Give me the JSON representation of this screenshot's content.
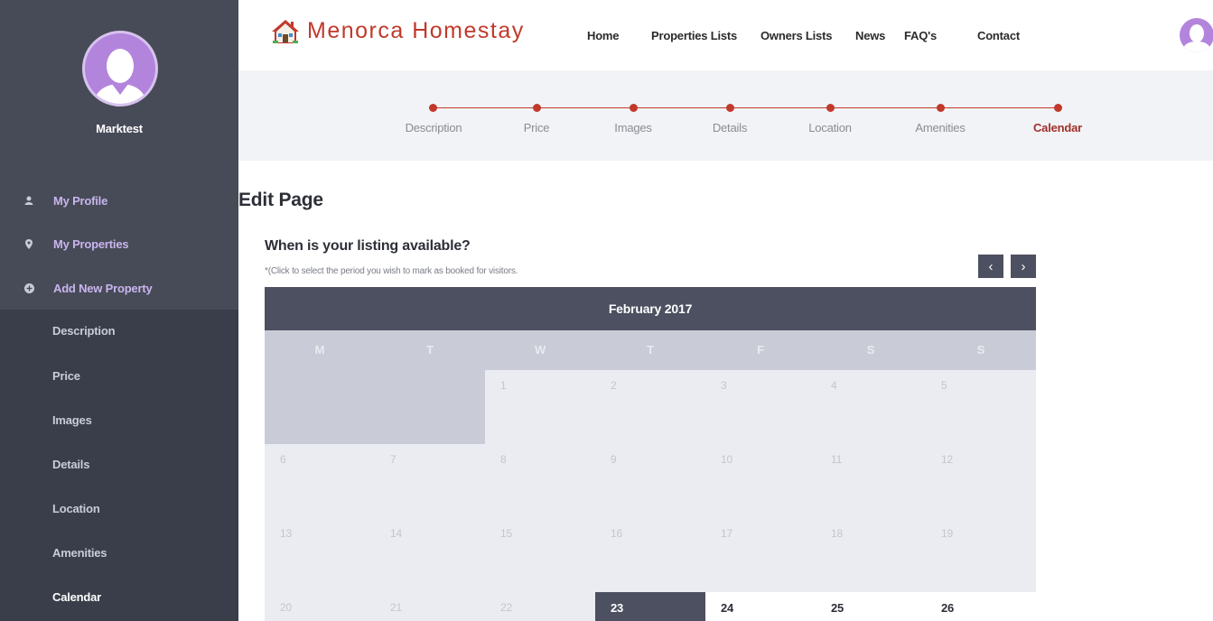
{
  "sidebar": {
    "username": "Marktest",
    "menu": [
      {
        "label": "My Profile",
        "icon": "user-icon"
      },
      {
        "label": "My Properties",
        "icon": "map-pin-icon"
      },
      {
        "label": "Add New Property",
        "icon": "plus-circle-icon"
      }
    ],
    "subitems": [
      "Description",
      "Price",
      "Images",
      "Details",
      "Location",
      "Amenities",
      "Calendar"
    ],
    "active_subitem": "Calendar"
  },
  "topbar": {
    "logo_text": "Menorca Homestay",
    "nav": [
      "Home",
      "Properties Lists",
      "Owners Lists",
      "News",
      "FAQ's",
      "Contact"
    ]
  },
  "stepper": {
    "steps": [
      "Description",
      "Price",
      "Images",
      "Details",
      "Location",
      "Amenities",
      "Calendar"
    ],
    "active_step": "Calendar"
  },
  "main": {
    "page_title": "Edit Page",
    "question": "When is your listing available?",
    "hint": "*(Click to select the period you wish to mark as booked for visitors.",
    "prev_glyph": "‹",
    "next_glyph": "›"
  },
  "calendar": {
    "month_label": "February 2017",
    "weekdays": [
      "M",
      "T",
      "W",
      "T",
      "F",
      "S",
      "S"
    ],
    "rows": [
      [
        "",
        "",
        "1",
        "2",
        "3",
        "4",
        "5"
      ],
      [
        "6",
        "7",
        "8",
        "9",
        "10",
        "11",
        "12"
      ],
      [
        "13",
        "14",
        "15",
        "16",
        "17",
        "18",
        "19"
      ],
      [
        "20",
        "21",
        "22",
        "23",
        "24",
        "25",
        "26"
      ]
    ],
    "today": "23",
    "available_days": [
      "24",
      "25",
      "26"
    ]
  },
  "colors": {
    "accent": "#c0392b",
    "sidebar_bg": "#3a3e4a",
    "sidebar_top_bg": "#474b57",
    "avatar": "#b384dc",
    "calendar_header": "#4c5060"
  }
}
